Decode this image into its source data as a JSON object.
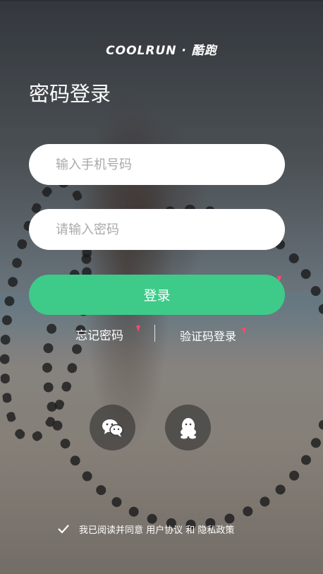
{
  "brand": {
    "logo_text": "COOLRUN · 酷跑"
  },
  "page": {
    "title": "密码登录"
  },
  "form": {
    "phone_placeholder": "输入手机号码",
    "password_placeholder": "请输入密码",
    "login_label": "登录"
  },
  "links": {
    "forgot_password": "忘记密码",
    "sms_login": "验证码登录"
  },
  "social": [
    {
      "icon": "wechat-icon"
    },
    {
      "icon": "qq-icon"
    }
  ],
  "agreement": {
    "checked": true,
    "text": "我已阅读并同意 用户协议 和 隐私政策"
  },
  "colors": {
    "accent": "#3ecb8a",
    "marker": "#ff4a6b"
  }
}
